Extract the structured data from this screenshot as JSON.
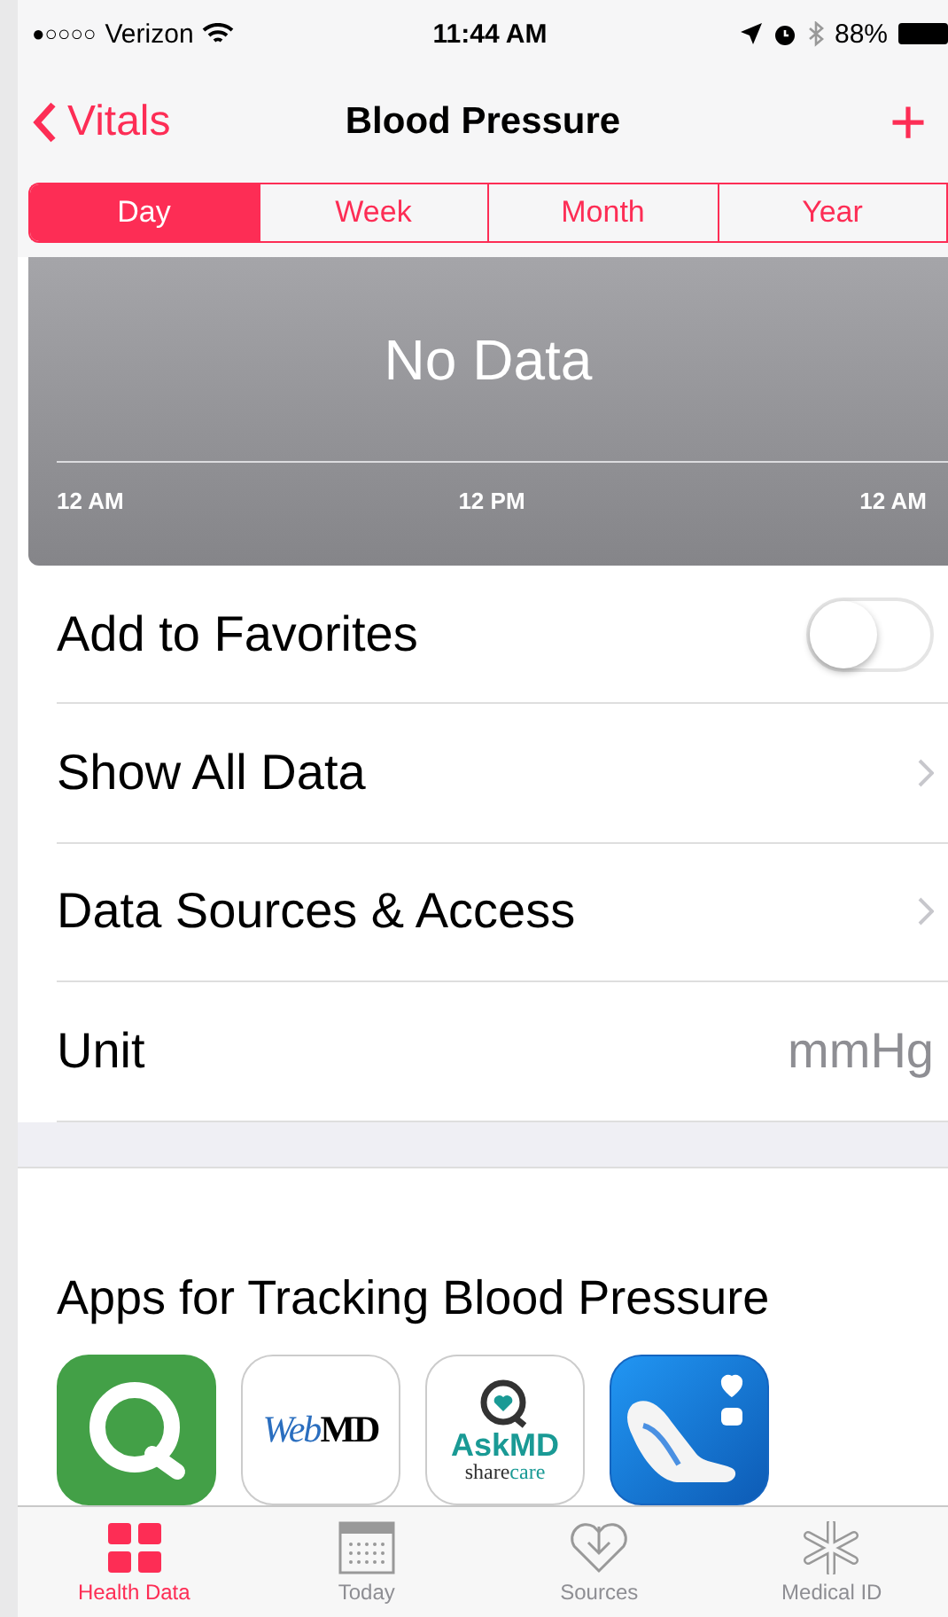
{
  "status_bar": {
    "signal": "●○○○○",
    "carrier": "Verizon",
    "time": "11:44 AM",
    "battery": "88%"
  },
  "nav": {
    "back": "Vitals",
    "title": "Blood Pressure",
    "add": "+"
  },
  "segments": [
    {
      "label": "Day",
      "selected": true
    },
    {
      "label": "Week",
      "selected": false
    },
    {
      "label": "Month",
      "selected": false
    },
    {
      "label": "Year",
      "selected": false
    }
  ],
  "chart": {
    "message": "No Data",
    "axis_labels": [
      "12 AM",
      "12 PM",
      "12 AM"
    ]
  },
  "rows": [
    {
      "kind": "toggle",
      "label": "Add to Favorites",
      "on": false
    },
    {
      "kind": "link",
      "label": "Show All Data"
    },
    {
      "kind": "link",
      "label": "Data Sources & Access"
    },
    {
      "kind": "value",
      "label": "Unit",
      "value": "mmHg"
    }
  ],
  "apps_section": {
    "title": "Apps for Tracking Blood Pressure",
    "apps": [
      {
        "kind": "q"
      },
      {
        "kind": "webmd",
        "text_a": "Web",
        "text_b": "MD"
      },
      {
        "kind": "askmd",
        "text_a": "AskMD",
        "text_b": "share",
        "text_c": "care"
      },
      {
        "kind": "shoe"
      }
    ]
  },
  "tab_bar": [
    {
      "kind": "grid",
      "label": "Health Data",
      "selected": true
    },
    {
      "kind": "calendar",
      "label": "Today",
      "selected": false
    },
    {
      "kind": "heart",
      "label": "Sources",
      "selected": false
    },
    {
      "kind": "asterisk",
      "label": "Medical ID",
      "selected": false
    }
  ]
}
